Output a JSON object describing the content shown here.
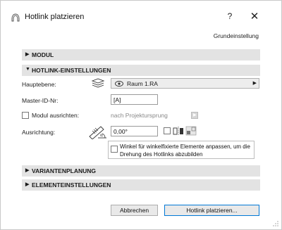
{
  "window": {
    "title": "Hotlink platzieren",
    "help": "?",
    "close": "✕"
  },
  "preset": "Grundeinstellung",
  "sections": {
    "modul": "MODUL",
    "hotlink": "HOTLINK-EINSTELLUNGEN",
    "variant": "VARIANTENPLANUNG",
    "element": "ELEMENTEINSTELLUNGEN"
  },
  "hotlink": {
    "hauptebene_label": "Hauptebene:",
    "hauptebene_value": "Raum 1.RA",
    "master_label": "Master-ID-Nr:",
    "master_value": "[A]",
    "align_label": "Modul ausrichten:",
    "align_value": "nach Projektursprung",
    "orientation_label": "Ausrichtung:",
    "orientation_value": "0,00°",
    "adjust_text": "Winkel für winkelfixierte Elemente anpassen, um die Drehung des Hotlinks abzubilden"
  },
  "buttons": {
    "cancel": "Abbrechen",
    "place": "Hotlink platzieren..."
  },
  "colors": {
    "section_bg": "#e3e3e3",
    "primary_border": "#0078d7"
  }
}
